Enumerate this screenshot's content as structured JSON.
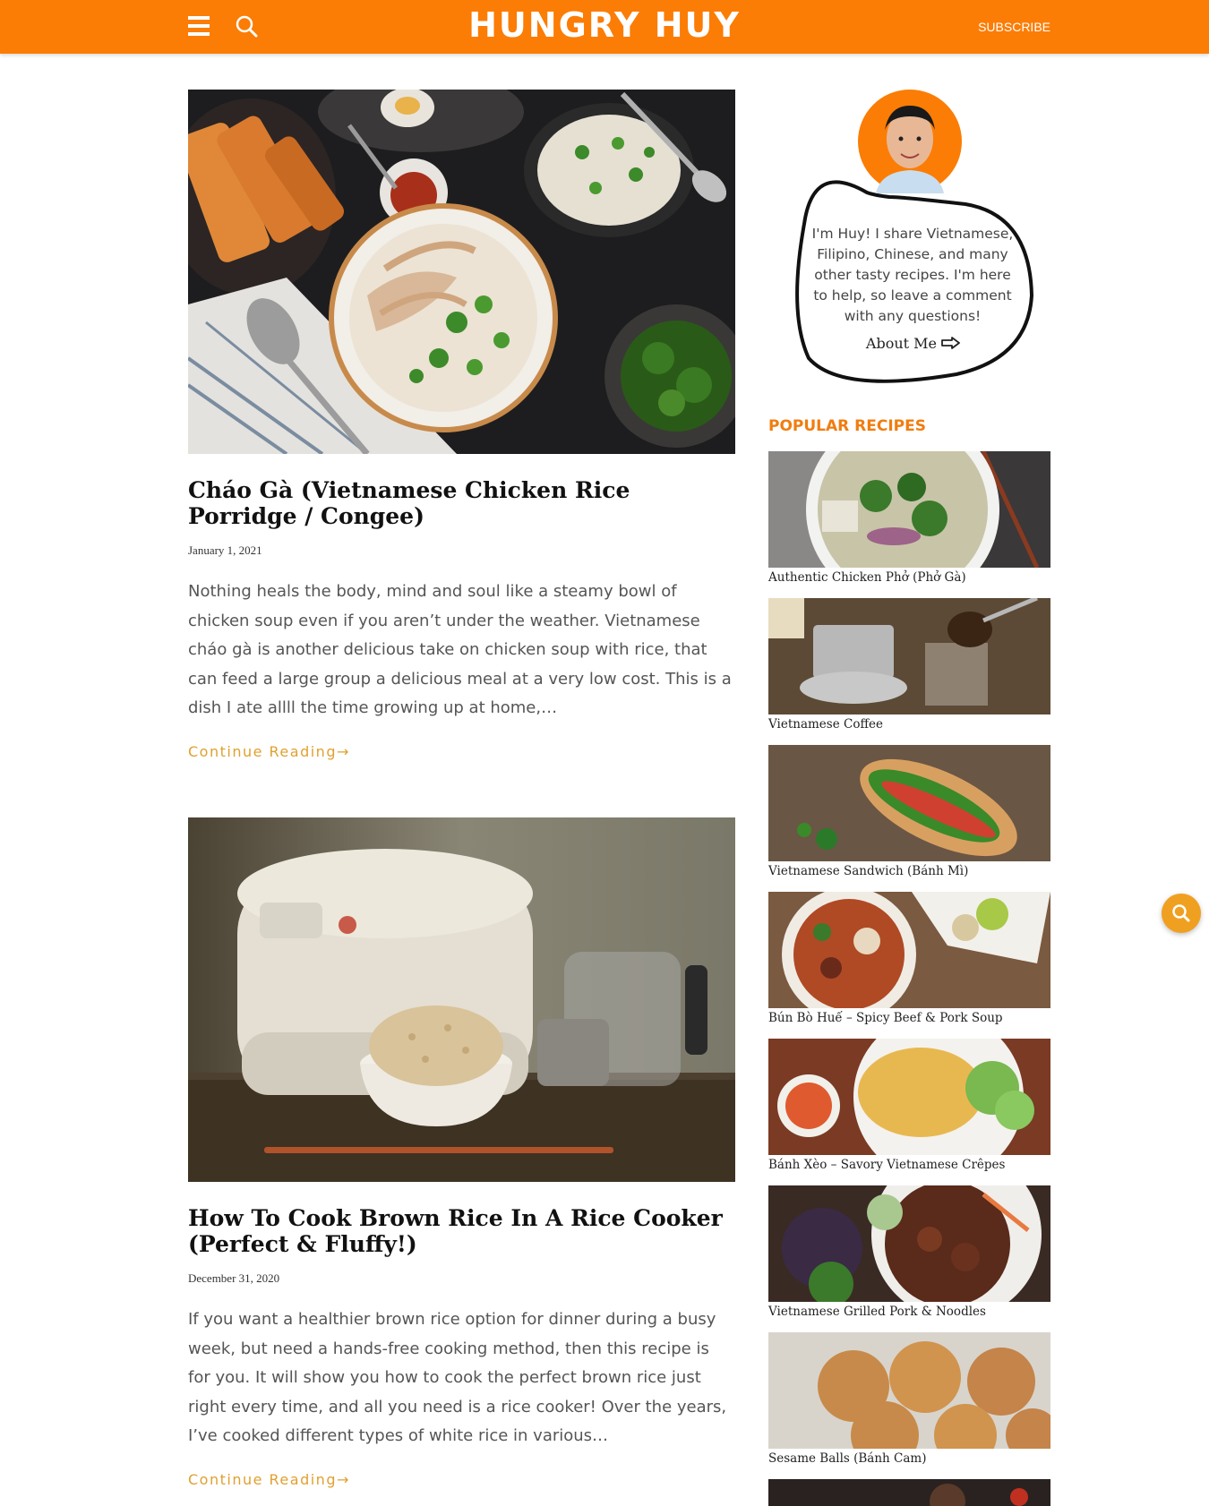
{
  "header": {
    "logo": "HUNGRY HUY",
    "subscribe": "SUBSCRIBE",
    "icons": [
      "menu-icon",
      "search-icon"
    ],
    "color": "#fb7d05"
  },
  "posts": [
    {
      "title": "Cháo Gà (Vietnamese Chicken Rice Porridge / Congee)",
      "date": "January 1, 2021",
      "excerpt": "Nothing heals the body, mind and soul like a steamy bowl of chicken soup even if you aren’t under the weather. Vietnamese cháo gà is another delicious take on chicken soup with rice, that can feed a large group a delicious meal at a very low cost. This is a dish I ate allll the time growing up at home,…",
      "continue": "Continue Reading→"
    },
    {
      "title": "How To Cook Brown Rice In A Rice Cooker (Perfect & Fluffy!)",
      "date": "December 31, 2020",
      "excerpt": "If you want a healthier brown rice option for dinner during a busy week, but need a hands-free cooking method, then this recipe is for you. It will show you how to cook the perfect brown rice just right every time, and all you need is a rice cooker!  Over the years, I’ve cooked different types of white rice in various…",
      "continue": "Continue Reading→"
    }
  ],
  "sidebar": {
    "about_text": "I'm Huy! I share Vietnamese, Filipino, Chinese, and many other tasty recipes. I'm here to help, so leave a comment with any questions!",
    "about_link": "About Me",
    "popular_title": "POPULAR RECIPES",
    "popular": [
      "Authentic Chicken Phở (Phở Gà)",
      "Vietnamese Coffee",
      "Vietnamese Sandwich (Bánh Mì)",
      "Bún Bò Huế – Spicy Beef & Pork Soup",
      "Bánh Xèo – Savory Vietnamese Crêpes",
      "Vietnamese Grilled Pork & Noodles",
      "Sesame Balls (Bánh Cam)"
    ]
  },
  "colors": {
    "accent": "#fb7d05",
    "link": "#e0a030",
    "popular_heading": "#f07d10"
  }
}
